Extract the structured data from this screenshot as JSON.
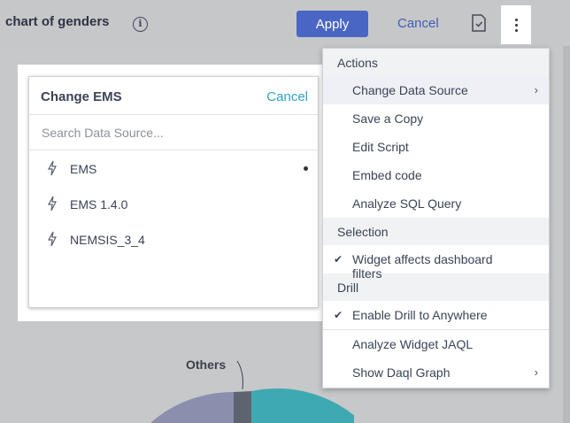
{
  "header": {
    "title": "chart of genders",
    "apply_label": "Apply",
    "cancel_label": "Cancel"
  },
  "chart": {
    "others_label": "Others"
  },
  "ems_panel": {
    "title": "Change EMS",
    "cancel_label": "Cancel",
    "search_placeholder": "Search Data Source...",
    "items": [
      {
        "label": "EMS",
        "selected": true
      },
      {
        "label": "EMS 1.4.0",
        "selected": false
      },
      {
        "label": "NEMSIS_3_4",
        "selected": false
      }
    ]
  },
  "menu": {
    "actions_header": "Actions",
    "change_data_source": "Change Data Source",
    "save_copy": "Save a Copy",
    "edit_script": "Edit Script",
    "embed_code": "Embed code",
    "analyze_sql": "Analyze SQL Query",
    "selection_header": "Selection",
    "widget_affects": "Widget affects dashboard filters",
    "drill_header": "Drill",
    "enable_drill": "Enable Drill to Anywhere",
    "analyze_jaql": "Analyze Widget JAQL",
    "show_daql": "Show Daql Graph"
  },
  "colors": {
    "apply_button": "#4a66c4",
    "cancel_link": "#2ea5c5",
    "chart_teal": "#3fa9b1",
    "chart_purple": "#8a8fae",
    "chart_gray": "#5e6370"
  }
}
